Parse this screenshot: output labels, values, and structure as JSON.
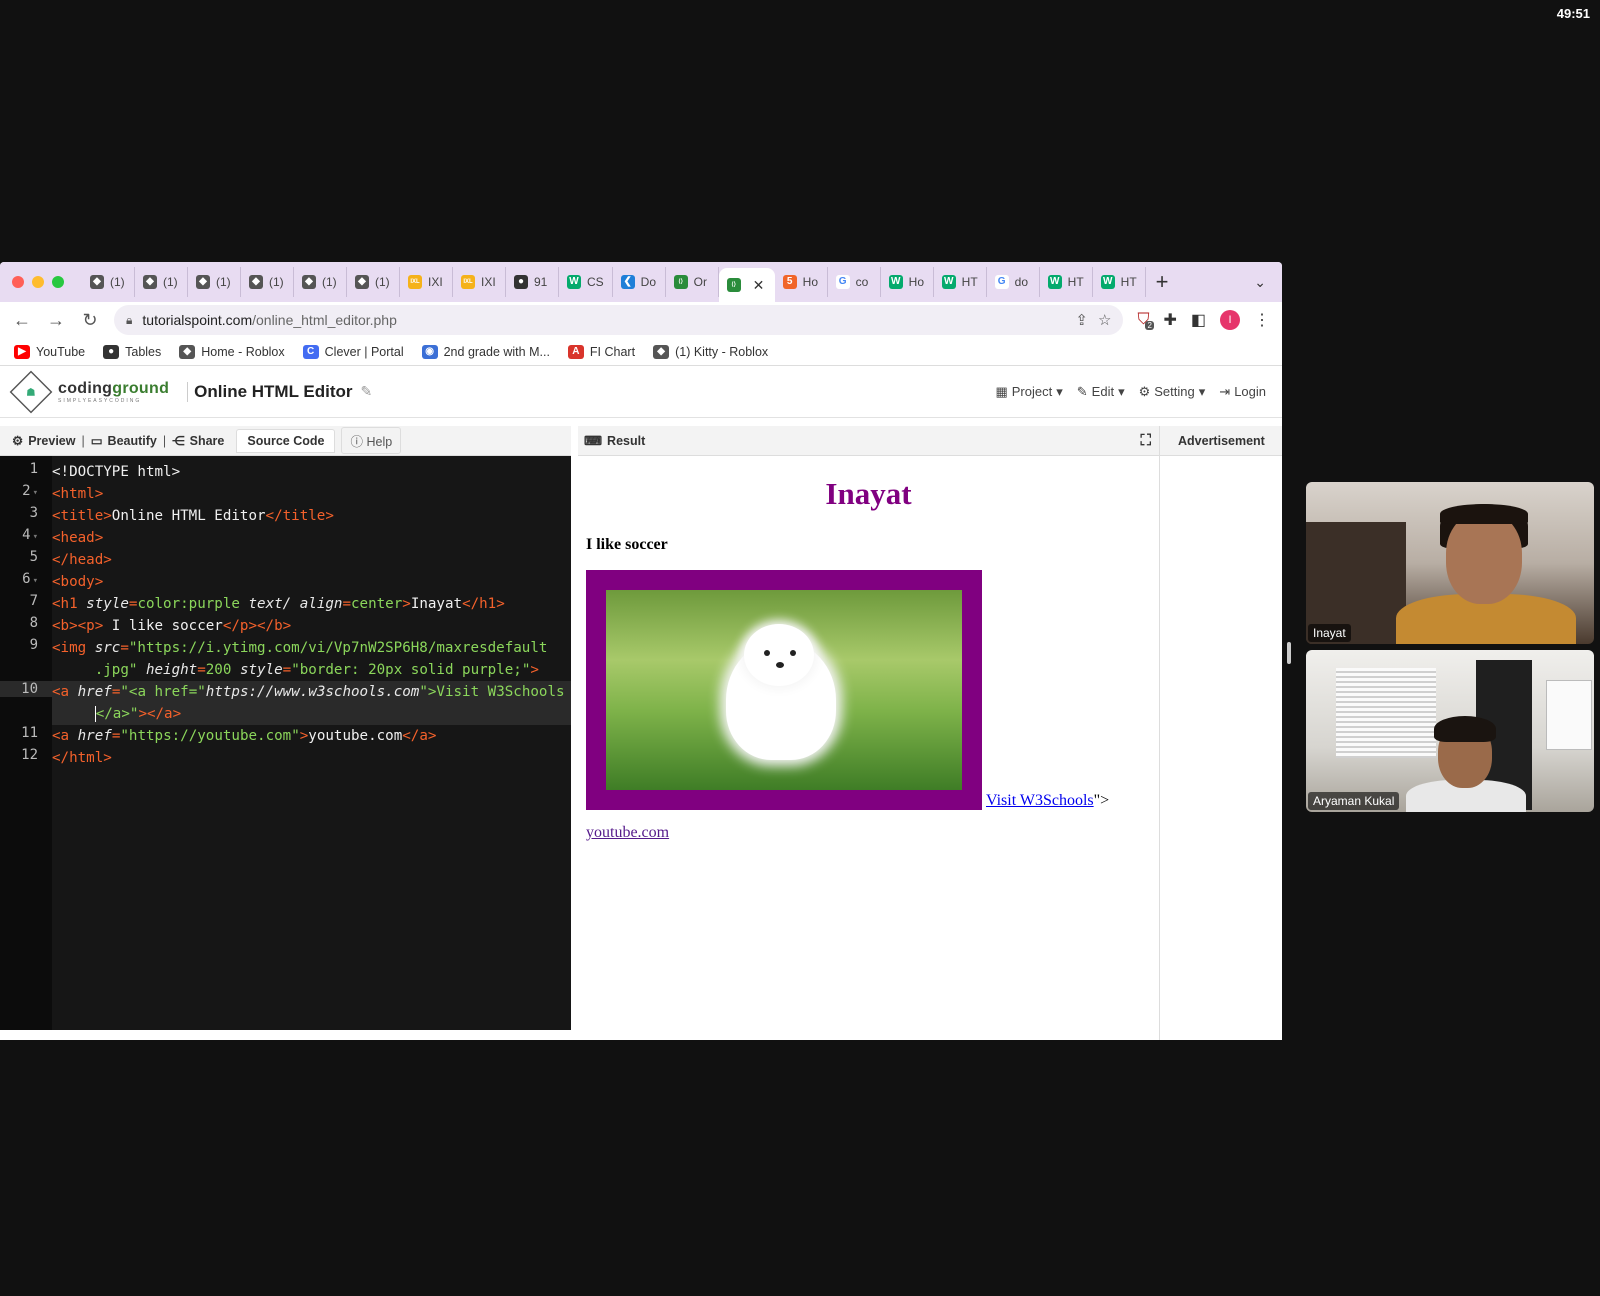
{
  "meeting": {
    "timer": "49:51"
  },
  "browser": {
    "tabs": [
      {
        "label": "(1)",
        "icon": "roblox-icon"
      },
      {
        "label": "(1)",
        "icon": "roblox-icon"
      },
      {
        "label": "(1)",
        "icon": "roblox-icon"
      },
      {
        "label": "(1)",
        "icon": "roblox-icon"
      },
      {
        "label": "(1)",
        "icon": "roblox-icon"
      },
      {
        "label": "(1)",
        "icon": "roblox-icon"
      },
      {
        "label": "IXI",
        "icon": "ixl-icon"
      },
      {
        "label": "IXI",
        "icon": "ixl-icon"
      },
      {
        "label": "91",
        "icon": "globe-icon"
      },
      {
        "label": "CS",
        "icon": "w3schools-icon"
      },
      {
        "label": "Do",
        "icon": "vscode-icon"
      },
      {
        "label": "Or",
        "icon": "code-icon"
      },
      {
        "label": "",
        "icon": "code-icon",
        "active": true
      },
      {
        "label": "Ho",
        "icon": "html5-icon"
      },
      {
        "label": "co",
        "icon": "google-icon"
      },
      {
        "label": "Ho",
        "icon": "w3schools-icon"
      },
      {
        "label": "HT",
        "icon": "w3schools-icon"
      },
      {
        "label": "do",
        "icon": "google-icon"
      },
      {
        "label": "HT",
        "icon": "w3schools-icon"
      },
      {
        "label": "HT",
        "icon": "w3schools-icon"
      }
    ],
    "address": {
      "host": "tutorialspoint.com",
      "path": "/online_html_editor.php"
    },
    "profile_initial": "I",
    "extension_badge": "2",
    "bookmarks": [
      {
        "label": "YouTube",
        "icon": "youtube-icon"
      },
      {
        "label": "Tables",
        "icon": "globe-icon"
      },
      {
        "label": "Home - Roblox",
        "icon": "roblox-icon"
      },
      {
        "label": "Clever | Portal",
        "icon": "clever-icon"
      },
      {
        "label": "2nd grade with M...",
        "icon": "contact-icon"
      },
      {
        "label": "FI Chart",
        "icon": "letter-a-icon"
      },
      {
        "label": "(1) Kitty - Roblox",
        "icon": "roblox-icon"
      }
    ]
  },
  "site": {
    "logo_text_a": "coding",
    "logo_text_b": "ground",
    "logo_tagline": "SIMPLYEASYCODING",
    "title": "Online HTML Editor",
    "menu": {
      "project": "Project",
      "edit": "Edit",
      "setting": "Setting",
      "login": "Login"
    }
  },
  "editor": {
    "toolbar": {
      "preview": "Preview",
      "beautify": "Beautify",
      "share": "Share",
      "source": "Source Code",
      "help": "Help"
    },
    "active_line": 10
  },
  "result": {
    "label": "Result",
    "ad_label": "Advertisement",
    "heading": "Inayat",
    "paragraph": "I like soccer",
    "link1": "Visit W3Schools",
    "link1_after": "\">",
    "link2": "youtube.com"
  },
  "participants": [
    {
      "name": "Inayat"
    },
    {
      "name": "Aryaman Kukal"
    }
  ],
  "colors": {
    "tabstrip": "#e8dcf2",
    "tag": "#f4612b",
    "string": "#8bd65b",
    "heading": "#800080"
  }
}
